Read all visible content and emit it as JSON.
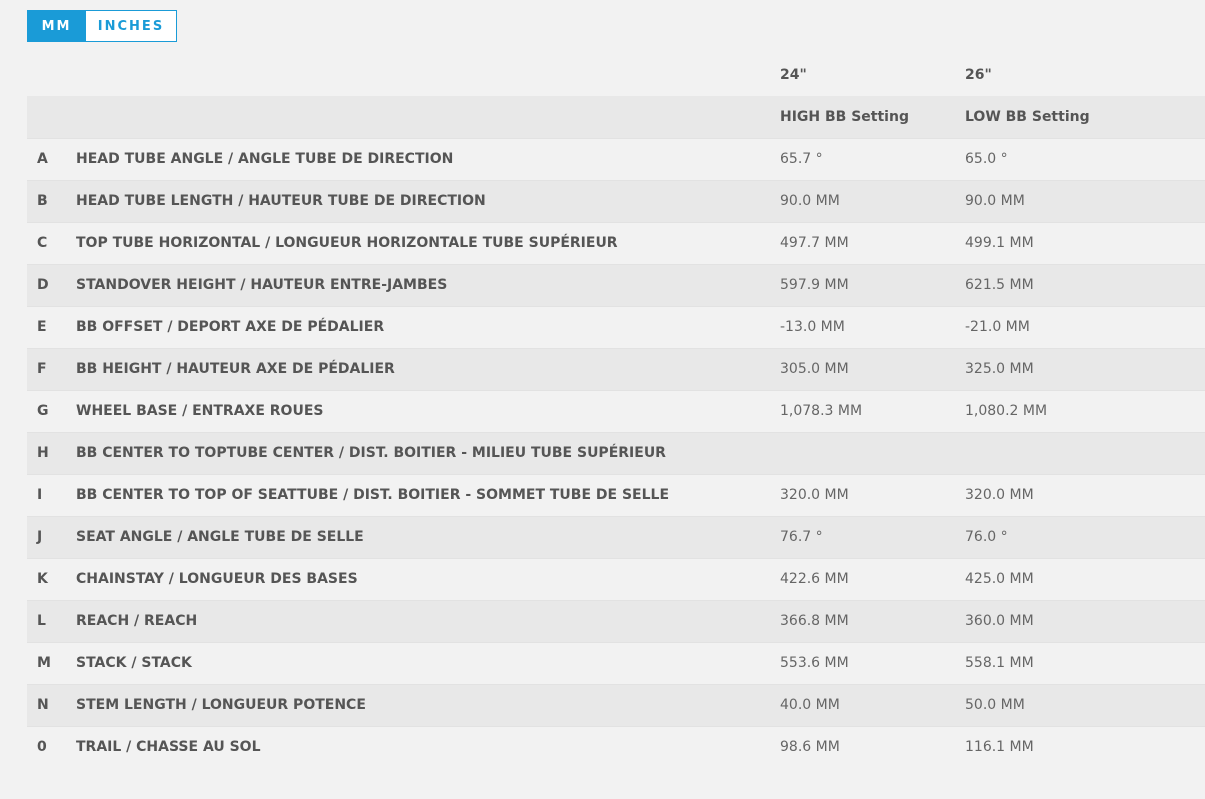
{
  "units": {
    "mm_label": "MM",
    "inches_label": "INCHES",
    "active": "MM",
    "accent_color": "#1a9bd7"
  },
  "columns": {
    "col1_size": "24\"",
    "col2_size": "26\"",
    "col1_setting": "HIGH BB Setting",
    "col2_setting": "LOW BB Setting"
  },
  "rows": [
    {
      "letter": "A",
      "label": "HEAD TUBE ANGLE / ANGLE TUBE DE DIRECTION",
      "v24": "65.7 °",
      "v26": "65.0 °"
    },
    {
      "letter": "B",
      "label": "HEAD TUBE LENGTH / HAUTEUR TUBE DE DIRECTION",
      "v24": "90.0 MM",
      "v26": "90.0 MM"
    },
    {
      "letter": "C",
      "label": "TOP TUBE HORIZONTAL / LONGUEUR HORIZONTALE TUBE SUPÉRIEUR",
      "v24": "497.7 MM",
      "v26": "499.1 MM"
    },
    {
      "letter": "D",
      "label": "STANDOVER HEIGHT / HAUTEUR ENTRE-JAMBES",
      "v24": "597.9 MM",
      "v26": "621.5 MM"
    },
    {
      "letter": "E",
      "label": "BB OFFSET / DEPORT AXE DE PÉDALIER",
      "v24": "-13.0 MM",
      "v26": "-21.0 MM"
    },
    {
      "letter": "F",
      "label": "BB HEIGHT / HAUTEUR AXE DE PÉDALIER",
      "v24": "305.0 MM",
      "v26": "325.0 MM"
    },
    {
      "letter": "G",
      "label": "WHEEL BASE / ENTRAXE ROUES",
      "v24": "1,078.3 MM",
      "v26": "1,080.2 MM"
    },
    {
      "letter": "H",
      "label": "BB CENTER TO TOPTUBE CENTER / DIST. BOITIER - MILIEU TUBE SUPÉRIEUR",
      "v24": "",
      "v26": ""
    },
    {
      "letter": "I",
      "label": "BB CENTER TO TOP OF SEATTUBE / DIST. BOITIER - SOMMET TUBE DE SELLE",
      "v24": "320.0 MM",
      "v26": "320.0 MM"
    },
    {
      "letter": "J",
      "label": "SEAT ANGLE / ANGLE TUBE DE SELLE",
      "v24": "76.7 °",
      "v26": "76.0 °"
    },
    {
      "letter": "K",
      "label": "CHAINSTAY / LONGUEUR DES BASES",
      "v24": "422.6 MM",
      "v26": "425.0 MM"
    },
    {
      "letter": "L",
      "label": "REACH / REACH",
      "v24": "366.8 MM",
      "v26": "360.0 MM"
    },
    {
      "letter": "M",
      "label": "STACK / STACK",
      "v24": "553.6 MM",
      "v26": "558.1 MM"
    },
    {
      "letter": "N",
      "label": "STEM LENGTH / LONGUEUR POTENCE",
      "v24": "40.0 MM",
      "v26": "50.0 MM"
    },
    {
      "letter": "0",
      "label": "TRAIL / CHASSE AU SOL",
      "v24": "98.6 MM",
      "v26": "116.1 MM"
    }
  ]
}
